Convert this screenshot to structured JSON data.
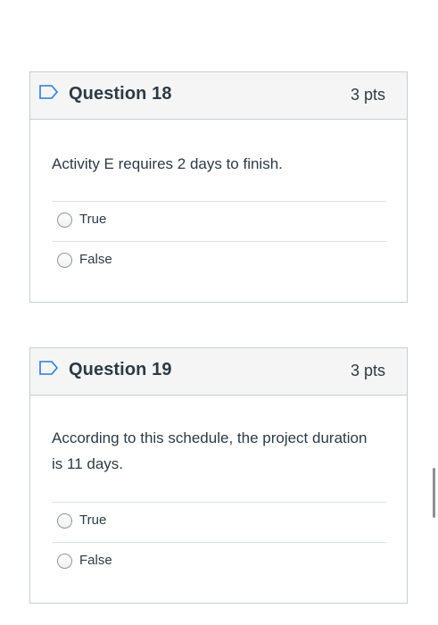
{
  "questions": [
    {
      "title": "Question 18",
      "points": "3 pts",
      "text": "Activity E requires 2 days to finish.",
      "answers": [
        {
          "label": "True"
        },
        {
          "label": "False"
        }
      ]
    },
    {
      "title": "Question 19",
      "points": "3 pts",
      "text": "According to this schedule, the project duration is 11 days.",
      "answers": [
        {
          "label": "True"
        },
        {
          "label": "False"
        }
      ]
    }
  ],
  "colors": {
    "header_bg": "#f5f5f5",
    "border": "#c7cdd1",
    "text": "#2d3b45"
  },
  "icons": {
    "flag": "flag-outline-icon"
  }
}
